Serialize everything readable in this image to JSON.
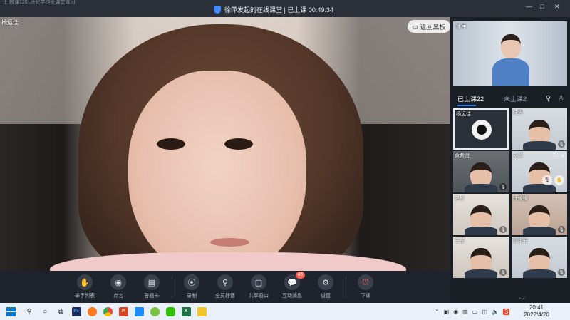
{
  "titlebar": {
    "faint_text": "上 教课1201班化学作业课堂练习",
    "title": "徐萍发起的在线课堂 | 已上课 00:49:34",
    "minimize": "—",
    "maximize": "□",
    "close": "✕"
  },
  "main_video": {
    "student_name": "杨运佳",
    "back_board_label": "返回黑板"
  },
  "toolbar": {
    "items": [
      {
        "label": "举手列表",
        "icon": "hand-icon"
      },
      {
        "label": "点名",
        "icon": "location-pin-icon"
      },
      {
        "label": "答题卡",
        "icon": "answer-card-icon"
      },
      {
        "label": "录制",
        "icon": "record-icon"
      },
      {
        "label": "全员静音",
        "icon": "mute-all-icon"
      },
      {
        "label": "共享窗口",
        "icon": "share-screen-icon"
      },
      {
        "label": "互动消息",
        "icon": "chat-icon",
        "badge": "46"
      },
      {
        "label": "设置",
        "icon": "gear-icon"
      },
      {
        "label": "下课",
        "icon": "power-icon"
      }
    ]
  },
  "panel": {
    "teacher_name": "徐萍",
    "tab_attended": "已上课22",
    "tab_absent": "未上课2",
    "participants": [
      {
        "name": "杨运佳",
        "style": "avatar"
      },
      {
        "name": "陆丹",
        "style": "c-white"
      },
      {
        "name": "黄紫澄",
        "style": "c-dark"
      },
      {
        "name": "刘鹏",
        "style": "c-white"
      },
      {
        "name": "赵杉",
        "style": "c-light"
      },
      {
        "name": "汪媛媛",
        "style": "c-warm"
      },
      {
        "name": "王彤",
        "style": "c-light"
      },
      {
        "name": "曾宇轩",
        "style": "c-white"
      }
    ]
  },
  "taskbar": {
    "time": "20:41",
    "date": "2022/4/20",
    "ps_label": "Ps",
    "ppt_label": "P",
    "xl_label": "X"
  }
}
